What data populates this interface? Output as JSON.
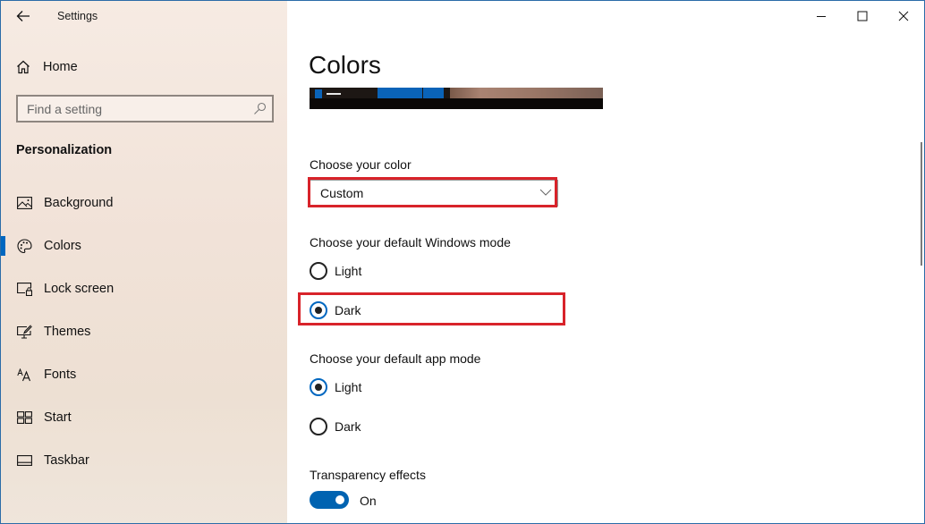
{
  "window": {
    "app_title": "Settings",
    "controls": {
      "minimize": "minimize-icon",
      "maximize": "maximize-icon",
      "close": "close-icon"
    }
  },
  "sidebar": {
    "home_label": "Home",
    "search": {
      "placeholder": "Find a setting",
      "value": ""
    },
    "section_title": "Personalization",
    "items": [
      {
        "label": "Background",
        "icon": "picture-icon",
        "active": false
      },
      {
        "label": "Colors",
        "icon": "palette-icon",
        "active": true
      },
      {
        "label": "Lock screen",
        "icon": "lock-screen-icon",
        "active": false
      },
      {
        "label": "Themes",
        "icon": "themes-icon",
        "active": false
      },
      {
        "label": "Fonts",
        "icon": "fonts-icon",
        "active": false
      },
      {
        "label": "Start",
        "icon": "start-icon",
        "active": false
      },
      {
        "label": "Taskbar",
        "icon": "taskbar-icon",
        "active": false
      }
    ],
    "accent_color": "#0067c0"
  },
  "main": {
    "page_title": "Colors",
    "choose_color": {
      "label": "Choose your color",
      "selected": "Custom"
    },
    "windows_mode": {
      "label": "Choose your default Windows mode",
      "options": [
        {
          "label": "Light",
          "checked": false
        },
        {
          "label": "Dark",
          "checked": true
        }
      ]
    },
    "app_mode": {
      "label": "Choose your default app mode",
      "options": [
        {
          "label": "Light",
          "checked": true
        },
        {
          "label": "Dark",
          "checked": false
        }
      ]
    },
    "transparency": {
      "label": "Transparency effects",
      "state_label": "On",
      "on": true
    },
    "highlight_color": "#d8232a",
    "accent_color": "#0063b1"
  }
}
